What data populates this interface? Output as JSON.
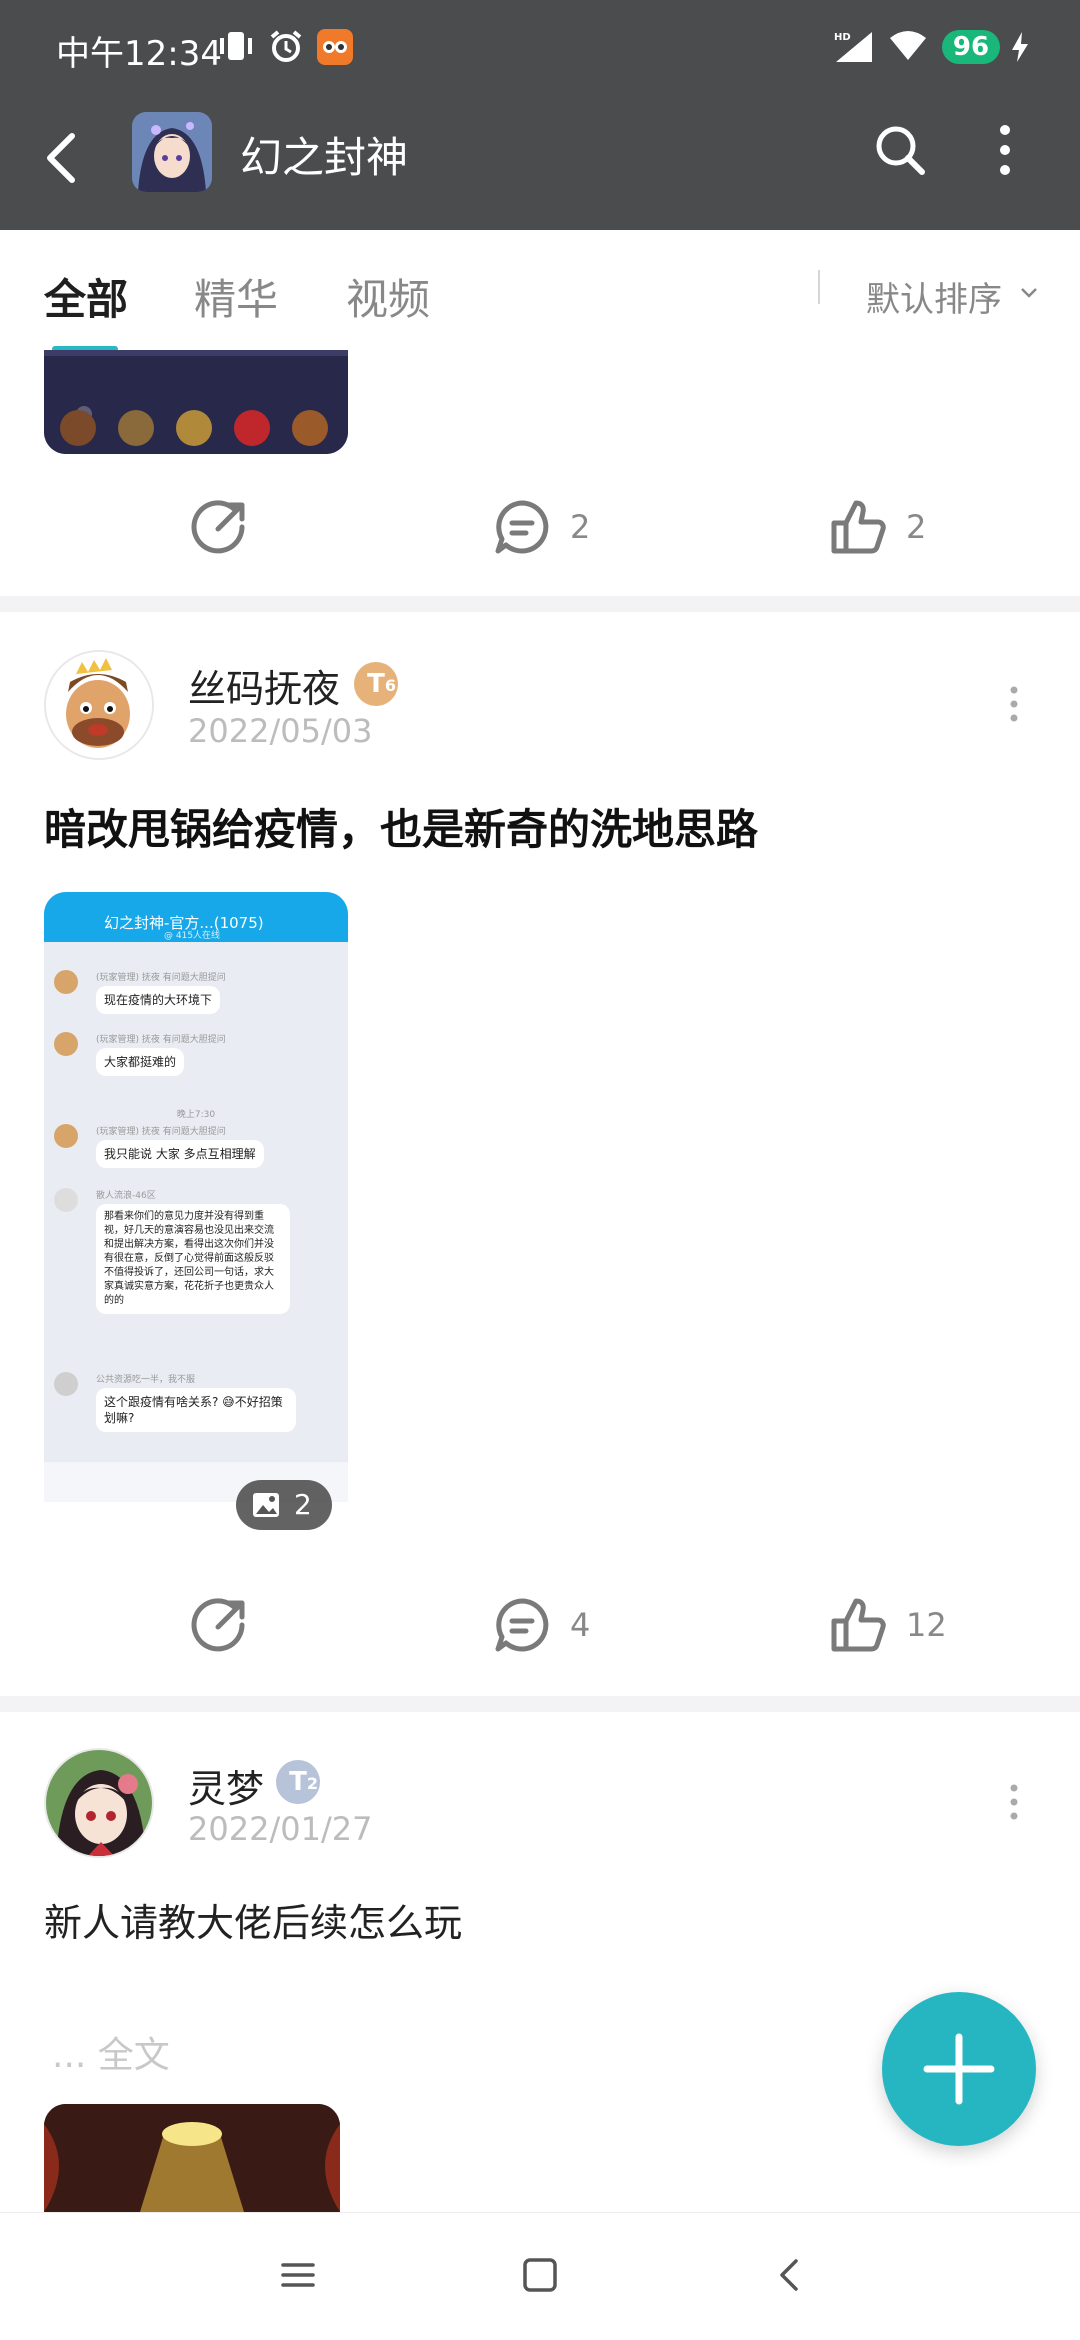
{
  "status_bar": {
    "time": "中午12:34",
    "battery": "96",
    "network": "HD"
  },
  "app_bar": {
    "title": "幻之封神"
  },
  "tabs": [
    {
      "label": "全部",
      "active": true
    },
    {
      "label": "精华",
      "active": false
    },
    {
      "label": "视频",
      "active": false
    }
  ],
  "sort": {
    "label": "默认排序"
  },
  "posts": [
    {
      "comments": "2",
      "likes": "2"
    },
    {
      "username": "丝码抚夜",
      "badge": {
        "letter": "T",
        "level": "6",
        "color": "#e7b27a"
      },
      "date": "2022/05/03",
      "title": "暗改甩锅给疫情，也是新奇的洗地思路",
      "screenshot": {
        "header_title": "幻之封神-官方...(1075)",
        "header_sub": "@ 415人在线",
        "messages": [
          {
            "meta": "(玩家管理) 抚夜 有问题大胆提问",
            "text": "现在疫情的大环境下"
          },
          {
            "meta": "(玩家管理) 抚夜 有问题大胆提问",
            "text": "大家都挺难的"
          },
          {
            "meta": "晚上7:30",
            "text": ""
          },
          {
            "meta": "(玩家管理) 抚夜 有问题大胆提问",
            "text": "我只能说 大家 多点互相理解"
          },
          {
            "meta": "散人流浪-46区",
            "text": "那看来你们的意见力度并没有得到重视，好几天的意演容易也没见出来交流和提出解决方案，看得出这次你们并没有很在意，反倒了心觉得前面这般反驳不值得投诉了，还回公司一句话，求大家真诚实意方案，花花折子也更贵众人的的"
          },
          {
            "meta": "公共资源吃一半，我不服",
            "text": "这个跟疫情有啥关系? 😅不好招策划嘛?"
          }
        ]
      },
      "image_count": "2",
      "comments": "4",
      "likes": "12"
    },
    {
      "username": "灵梦",
      "badge": {
        "letter": "T",
        "level": "2",
        "color": "#b7c3d8"
      },
      "date": "2022/01/27",
      "body": "新人请教大佬后续怎么玩",
      "fulltext": "... 全文"
    }
  ],
  "colors": {
    "header_bg": "#4a4c4e",
    "accent": "#25b6c2"
  }
}
